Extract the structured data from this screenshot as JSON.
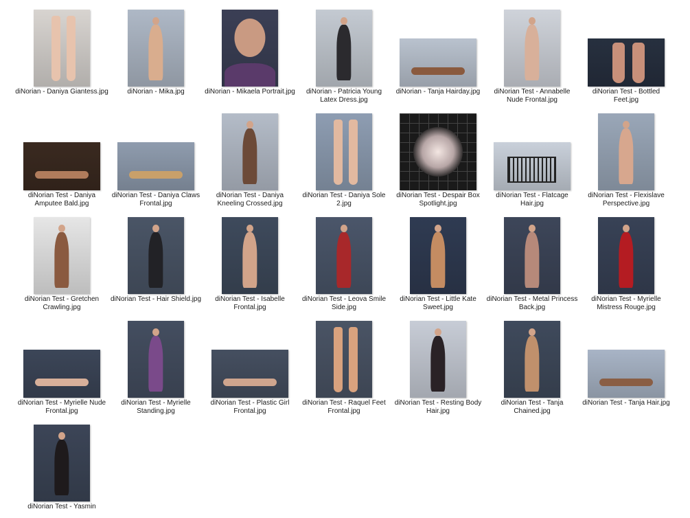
{
  "files": [
    {
      "name": "diNorian - Daniya Giantess.jpg",
      "orient": "portrait",
      "bg": "#d8d4d0",
      "subject": "#e7c3ad",
      "kind": "feet"
    },
    {
      "name": "diNorian - Mika.jpg",
      "orient": "portrait",
      "bg": "#aeb8c6",
      "subject": "#d9ad8e",
      "kind": "figure"
    },
    {
      "name": "diNorian - Mikaela Portrait.jpg",
      "orient": "portrait",
      "bg": "#3b3f55",
      "subject": "#c99a82",
      "kind": "portrait"
    },
    {
      "name": "diNorian - Patricia Young Latex Dress.jpg",
      "orient": "portrait",
      "bg": "#c4cad2",
      "subject": "#2b2a2e",
      "kind": "figure"
    },
    {
      "name": "diNorian - Tanja Hairday.jpg",
      "orient": "landscape",
      "bg": "#b9c2ce",
      "subject": "#8a5a3e",
      "kind": "lying"
    },
    {
      "name": "diNorian Test - Annabelle Nude Frontal.jpg",
      "orient": "portrait",
      "bg": "#cfd3da",
      "subject": "#d8b09a",
      "kind": "figure"
    },
    {
      "name": "diNorian Test - Bottled Feet.jpg",
      "orient": "landscape",
      "bg": "#27303f",
      "subject": "#c8907a",
      "kind": "feet"
    },
    {
      "name": "diNorian Test - Daniya Amputee Bald.jpg",
      "orient": "landscape",
      "bg": "#3a2a20",
      "subject": "#b07c5c",
      "kind": "lying"
    },
    {
      "name": "diNorian Test - Daniya Claws Frontal.jpg",
      "orient": "landscape",
      "bg": "#8f9cae",
      "subject": "#c9a06a",
      "kind": "lying"
    },
    {
      "name": "diNorian Test - Daniya Kneeling Crossed.jpg",
      "orient": "portrait",
      "bg": "#b4bcc8",
      "subject": "#6c4a38",
      "kind": "figure"
    },
    {
      "name": "diNorian Test - Daniya Sole 2.jpg",
      "orient": "portrait",
      "bg": "#8e9db2",
      "subject": "#e2b9a0",
      "kind": "feet"
    },
    {
      "name": "diNorian Test - Despair Box Spotlight.jpg",
      "orient": "square",
      "bg": "#1a1a1a",
      "subject": "#d7a89a",
      "kind": "box"
    },
    {
      "name": "diNorian Test - Flatcage Hair.jpg",
      "orient": "landscape",
      "bg": "#c9d0da",
      "subject": "#3a3030",
      "kind": "cage"
    },
    {
      "name": "diNorian Test - Flexislave Perspective.jpg",
      "orient": "portrait",
      "bg": "#9aa7b8",
      "subject": "#d7a78e",
      "kind": "figure"
    },
    {
      "name": "diNorian Test - Gretchen Crawling.jpg",
      "orient": "portrait",
      "bg": "#e6e6e6",
      "subject": "#8a5a40",
      "kind": "crawl"
    },
    {
      "name": "diNorian Test - Hair Shield.jpg",
      "orient": "portrait",
      "bg": "#4a5566",
      "subject": "#222226",
      "kind": "figure"
    },
    {
      "name": "diNorian Test - Isabelle Frontal.jpg",
      "orient": "portrait",
      "bg": "#3e4a5c",
      "subject": "#d2a48a",
      "kind": "figure"
    },
    {
      "name": "diNorian Test - Leova Smile Side.jpg",
      "orient": "portrait",
      "bg": "#4b566a",
      "subject": "#a8282a",
      "kind": "figure"
    },
    {
      "name": "diNorian Test - Little Kate Sweet.jpg",
      "orient": "portrait",
      "bg": "#2f3b52",
      "subject": "#c48c62",
      "kind": "figure"
    },
    {
      "name": "diNorian Test - Metal Princess Back.jpg",
      "orient": "portrait",
      "bg": "#3d4659",
      "subject": "#b6897a",
      "kind": "figure"
    },
    {
      "name": "diNorian Test - Myrielle Mistress Rouge.jpg",
      "orient": "portrait",
      "bg": "#384256",
      "subject": "#b41c22",
      "kind": "figure"
    },
    {
      "name": "diNorian Test - Myrielle Nude Frontal.jpg",
      "orient": "landscape",
      "bg": "#3c4658",
      "subject": "#d8b09a",
      "kind": "lying"
    },
    {
      "name": "diNorian Test - Myrielle Standing.jpg",
      "orient": "portrait",
      "bg": "#444e60",
      "subject": "#7a4a8a",
      "kind": "figure"
    },
    {
      "name": "diNorian Test - Plastic Girl Frontal.jpg",
      "orient": "landscape",
      "bg": "#454f60",
      "subject": "#cfa58e",
      "kind": "lying"
    },
    {
      "name": "diNorian Test - Raquel Feet Frontal.jpg",
      "orient": "portrait",
      "bg": "#4a5465",
      "subject": "#d9a27e",
      "kind": "legs"
    },
    {
      "name": "diNorian Test - Resting Body Hair.jpg",
      "orient": "portrait",
      "bg": "#c7ccd6",
      "subject": "#2a2226",
      "kind": "figure"
    },
    {
      "name": "diNorian Test - Tanja Chained.jpg",
      "orient": "portrait",
      "bg": "#3f4a5c",
      "subject": "#c0906c",
      "kind": "figure"
    },
    {
      "name": "diNorian Test - Tanja Hair.jpg",
      "orient": "landscape",
      "bg": "#a8b4c6",
      "subject": "#8a5e44",
      "kind": "lying"
    },
    {
      "name": "diNorian Test - Yasmin",
      "orient": "portrait",
      "bg": "#3c4557",
      "subject": "#1e1a1c",
      "kind": "figure"
    }
  ]
}
